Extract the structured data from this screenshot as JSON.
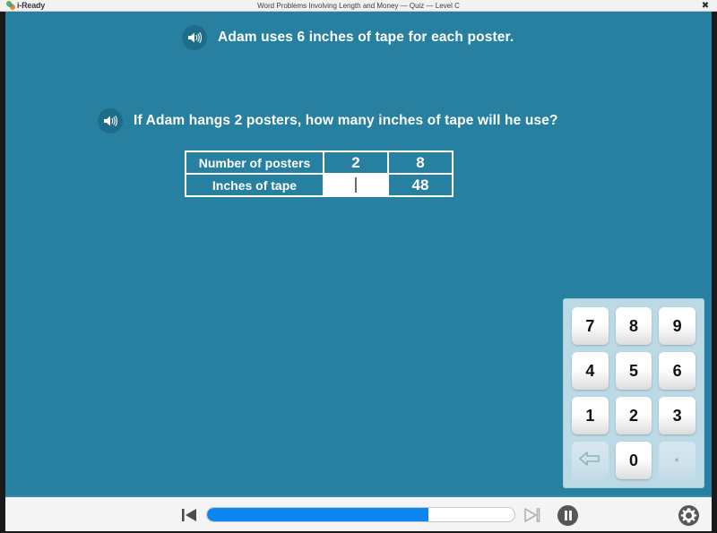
{
  "titlebar": {
    "brand": "i-Ready",
    "logo_icon": "iready-logo-icon",
    "title": "Word Problems Involving Length and Money — Quiz — Level C",
    "close_label": "✖",
    "close_icon": "close-icon"
  },
  "stage": {
    "background_color": "#27809f",
    "questions": [
      {
        "speaker_icon": "speaker-icon",
        "text": "Adam uses 6 inches of tape for each poster."
      },
      {
        "speaker_icon": "speaker-icon",
        "text": "If Adam hangs 2 posters, how many inches of tape will he use?"
      }
    ],
    "table": {
      "rows": [
        {
          "label": "Number of posters",
          "cells": [
            "2",
            "8"
          ]
        },
        {
          "label": "Inches of tape",
          "cells": [
            "",
            "48"
          ]
        }
      ],
      "answer_cell_value": "",
      "answer_cell_has_caret": true
    },
    "numpad": {
      "panel_color": "#bcdae6",
      "keys": [
        {
          "label": "7",
          "name": "numpad-key-7",
          "disabled": false
        },
        {
          "label": "8",
          "name": "numpad-key-8",
          "disabled": false
        },
        {
          "label": "9",
          "name": "numpad-key-9",
          "disabled": false
        },
        {
          "label": "4",
          "name": "numpad-key-4",
          "disabled": false
        },
        {
          "label": "5",
          "name": "numpad-key-5",
          "disabled": false
        },
        {
          "label": "6",
          "name": "numpad-key-6",
          "disabled": false
        },
        {
          "label": "1",
          "name": "numpad-key-1",
          "disabled": false
        },
        {
          "label": "2",
          "name": "numpad-key-2",
          "disabled": false
        },
        {
          "label": "3",
          "name": "numpad-key-3",
          "disabled": false
        },
        {
          "label": "",
          "name": "numpad-key-backspace",
          "icon": "backspace-arrow-icon",
          "disabled": true
        },
        {
          "label": "0",
          "name": "numpad-key-0",
          "disabled": false
        },
        {
          "label": "·",
          "name": "numpad-key-decimal",
          "disabled": true
        }
      ]
    }
  },
  "footer": {
    "prev_icon": "skip-previous-icon",
    "next_icon": "skip-next-icon",
    "pause_icon": "pause-icon",
    "settings_icon": "gear-icon",
    "progress_percent": 72,
    "progress_fill_color": "#0b86f0",
    "next_disabled": true
  }
}
